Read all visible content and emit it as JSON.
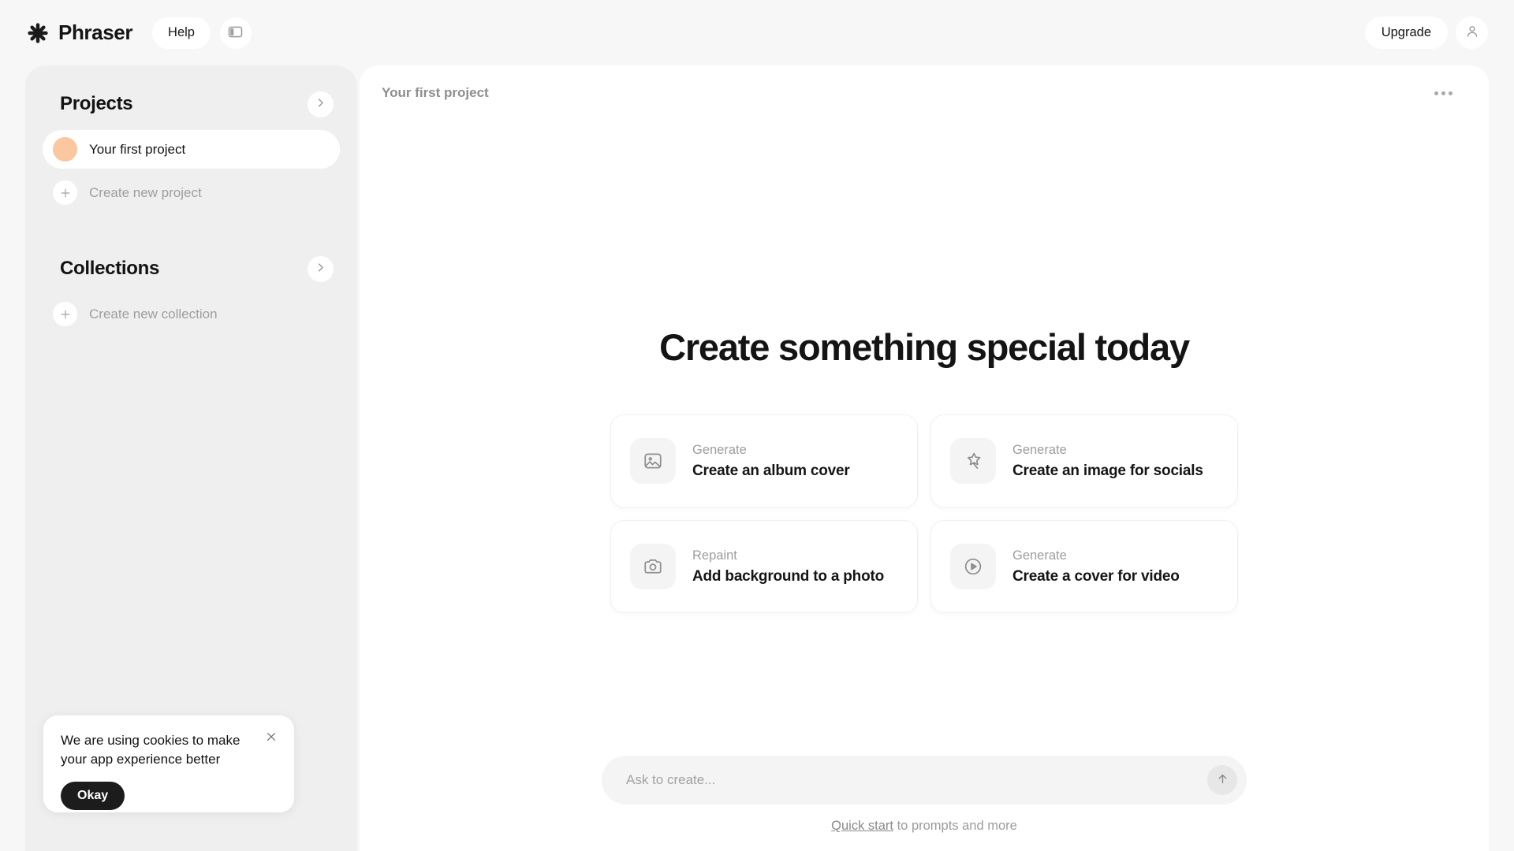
{
  "app": {
    "brand_name": "Phraser",
    "logo_icon": "asterisk-flower-icon"
  },
  "topbar": {
    "help_label": "Help",
    "panel_toggle_icon": "sidebar-panel-icon",
    "upgrade_label": "Upgrade",
    "account_icon": "user-avatar-icon"
  },
  "sidebar": {
    "projects": {
      "title": "Projects",
      "expand_icon": "chevron-right-icon",
      "items": [
        {
          "label": "Your first project",
          "avatar_color": "#fac7a0",
          "active": true
        }
      ],
      "create_label": "Create new project",
      "create_icon": "plus-icon"
    },
    "collections": {
      "title": "Collections",
      "expand_icon": "chevron-right-icon",
      "create_label": "Create new collection",
      "create_icon": "plus-icon"
    }
  },
  "cookie_banner": {
    "message": "We are using cookies to make your app experience better",
    "accept_label": "Okay",
    "close_icon": "close-x-icon"
  },
  "main": {
    "breadcrumb": "Your first project",
    "more_icon": "ellipsis-horizontal-icon",
    "hero_title": "Create something special today",
    "cards": [
      {
        "kicker": "Generate",
        "title": "Create an album cover",
        "icon": "image-picture-icon"
      },
      {
        "kicker": "Generate",
        "title": "Create an image for socials",
        "icon": "magic-wand-star-icon"
      },
      {
        "kicker": "Repaint",
        "title": "Add background to a photo",
        "icon": "camera-icon"
      },
      {
        "kicker": "Generate",
        "title": "Create a cover for video",
        "icon": "play-circle-icon"
      }
    ],
    "composer": {
      "placeholder": "Ask to create...",
      "send_icon": "arrow-up-icon"
    },
    "footer": {
      "link_label": "Quick start",
      "rest_label": " to prompts and more"
    }
  },
  "colors": {
    "page_background": "#f7f7f7",
    "sidebar_background": "#efefef",
    "panel_background": "#ffffff",
    "accent_avatar": "#fac7a0",
    "text_primary": "#141414",
    "text_muted": "#9d9d9d",
    "button_dark": "#1c1c1c"
  }
}
